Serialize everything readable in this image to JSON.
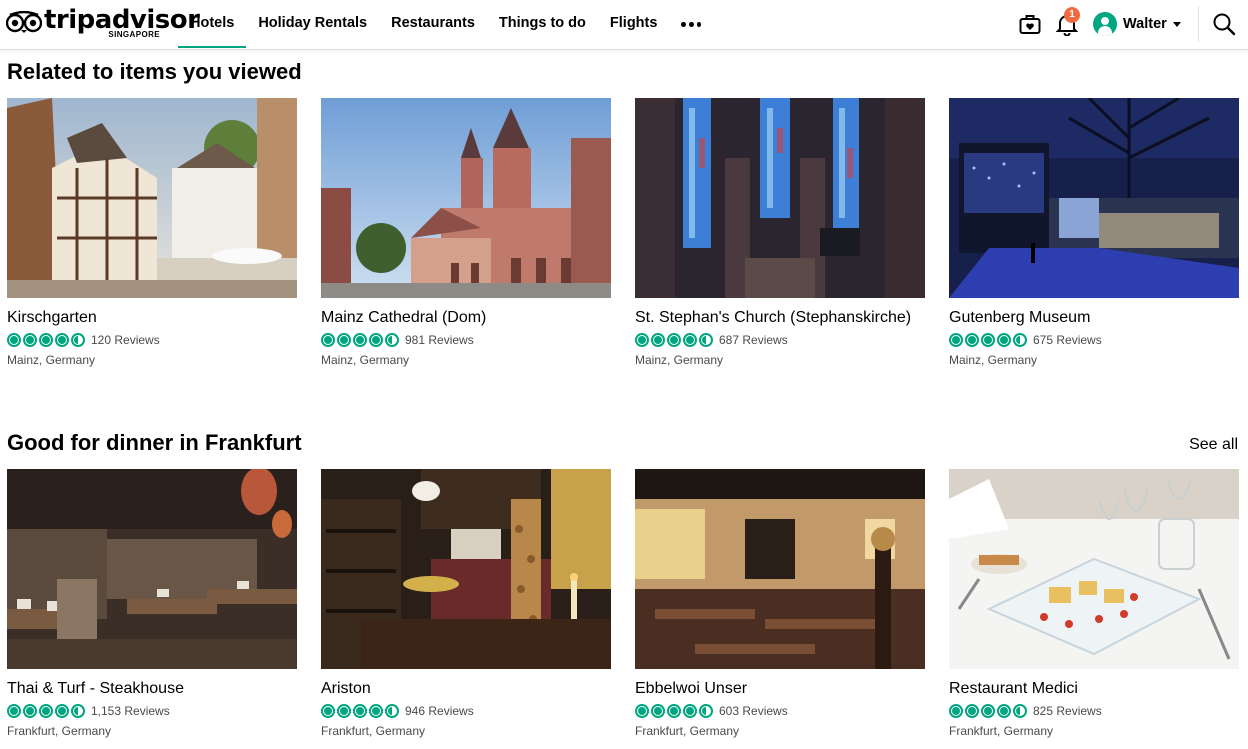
{
  "brand": {
    "name": "tripadvisor",
    "region": "SINGAPORE",
    "accent": "#00a680",
    "badge_color": "#f06b42"
  },
  "nav": [
    {
      "label": "Hotels",
      "active": true
    },
    {
      "label": "Holiday Rentals",
      "active": false
    },
    {
      "label": "Restaurants",
      "active": false
    },
    {
      "label": "Things to do",
      "active": false
    },
    {
      "label": "Flights",
      "active": false
    }
  ],
  "header_icons": {
    "trips": "suitcase-heart-icon",
    "notifications": "bell-icon",
    "search": "search-icon",
    "more": "more-dots-icon"
  },
  "notifications": {
    "count": "1"
  },
  "user": {
    "name": "Walter"
  },
  "sections": [
    {
      "title": "Related to items you viewed",
      "see_all": "",
      "cards": [
        {
          "name": "Kirschgarten",
          "rating": 4.5,
          "reviews": "120 Reviews",
          "location": "Mainz, Germany"
        },
        {
          "name": "Mainz Cathedral (Dom)",
          "rating": 4.5,
          "reviews": "981 Reviews",
          "location": "Mainz, Germany"
        },
        {
          "name": "St. Stephan's Church (Stephanskirche)",
          "rating": 4.5,
          "reviews": "687 Reviews",
          "location": "Mainz, Germany"
        },
        {
          "name": "Gutenberg Museum",
          "rating": 4.5,
          "reviews": "675 Reviews",
          "location": "Mainz, Germany"
        }
      ]
    },
    {
      "title": "Good for dinner in Frankfurt",
      "see_all": "See all",
      "cards": [
        {
          "name": "Thai & Turf - Steakhouse",
          "rating": 4.5,
          "reviews": "1,153 Reviews",
          "location": "Frankfurt, Germany"
        },
        {
          "name": "Ariston",
          "rating": 4.5,
          "reviews": "946 Reviews",
          "location": "Frankfurt, Germany"
        },
        {
          "name": "Ebbelwoi Unser",
          "rating": 4.5,
          "reviews": "603 Reviews",
          "location": "Frankfurt, Germany"
        },
        {
          "name": "Restaurant Medici",
          "rating": 4.5,
          "reviews": "825 Reviews",
          "location": "Frankfurt, Germany"
        }
      ]
    }
  ]
}
